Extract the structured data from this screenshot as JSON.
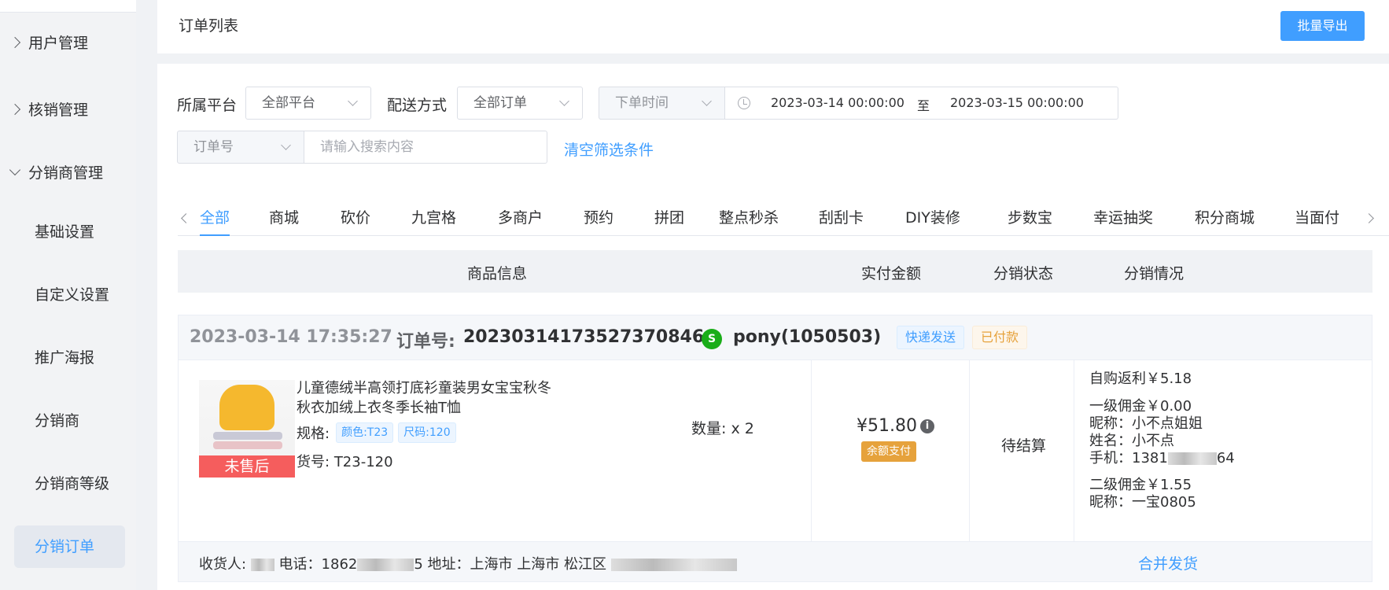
{
  "sidebar": {
    "groups": [
      {
        "label": "用户管理",
        "expanded": false
      },
      {
        "label": "核销管理",
        "expanded": false
      },
      {
        "label": "分销商管理",
        "expanded": true
      }
    ],
    "items": [
      {
        "label": "基础设置"
      },
      {
        "label": "自定义设置"
      },
      {
        "label": "推广海报"
      },
      {
        "label": "分销商"
      },
      {
        "label": "分销商等级"
      },
      {
        "label": "分销订单",
        "active": true
      }
    ]
  },
  "header": {
    "title": "订单列表",
    "export_label": "批量导出"
  },
  "filters": {
    "platform_label": "所属平台",
    "platform_value": "全部平台",
    "delivery_label": "配送方式",
    "delivery_value": "全部订单",
    "time_type": "下单时间",
    "date_start": "2023-03-14 00:00:00",
    "date_sep": "至",
    "date_end": "2023-03-15 00:00:00",
    "search_type": "订单号",
    "search_placeholder": "请输入搜索内容",
    "clear_label": "清空筛选条件"
  },
  "tabs": [
    "全部",
    "商城",
    "砍价",
    "九宫格",
    "多商户",
    "预约",
    "拼团",
    "整点秒杀",
    "刮刮卡",
    "DIY装修",
    "步数宝",
    "幸运抽奖",
    "积分商城",
    "当面付"
  ],
  "active_tab": "全部",
  "table": {
    "columns": [
      "商品信息",
      "实付金额",
      "分销状态",
      "分销情况"
    ]
  },
  "order": {
    "time": "2023-03-14 17:35:27",
    "order_no_label": "订单号:",
    "order_no": "20230314173527370846",
    "user": "pony(1050503)",
    "tags": [
      "快递发送",
      "已付款"
    ],
    "product": {
      "title": "儿童德绒半高领打底衫童装男女宝宝秋冬秋衣加绒上衣冬季长袖T恤",
      "badge": "未售后",
      "spec_label": "规格:",
      "specs": [
        "颜色:T23",
        "尺码:120"
      ],
      "sku_label": "货号:",
      "sku": "T23-120",
      "qty_label": "数量:",
      "qty": "x 2"
    },
    "amount": "¥51.80",
    "pay_method": "余额支付",
    "status": "待结算",
    "distribution": {
      "self_rebate": "自购返利￥5.18",
      "level1": "一级佣金￥0.00",
      "level1_nick": "昵称：小不点姐姐",
      "level1_name": "姓名：小不点",
      "level1_phone_prefix": "手机：1381",
      "level1_phone_suffix": "64",
      "level2": "二级佣金￥1.55",
      "level2_nick": "昵称：一宝0805"
    },
    "footer": {
      "receiver_label": "收货人:",
      "phone_label": "电话：1862",
      "phone_suffix": "5",
      "address_label": "地址：上海市 上海市 松江区",
      "merge_label": "合并发货"
    }
  },
  "colors": {
    "accent": "#409eff",
    "warning": "#e6a23c",
    "badge_red": "#f56c6c",
    "wechat_green": "#1aad19"
  }
}
